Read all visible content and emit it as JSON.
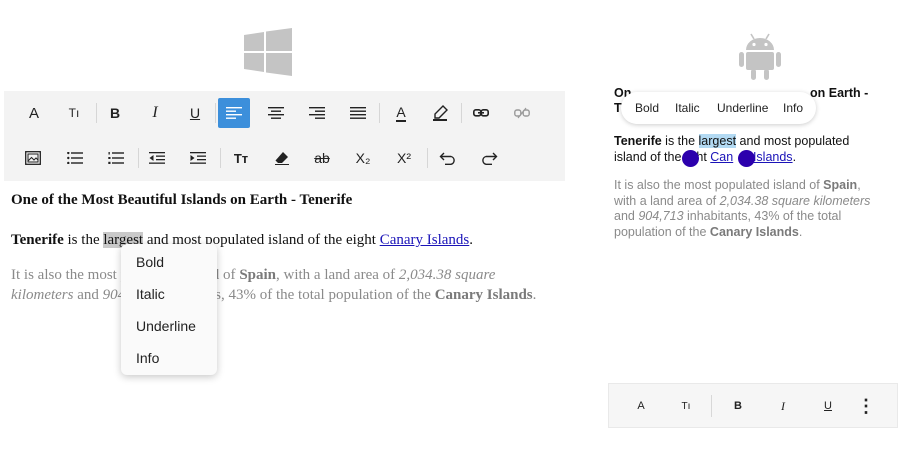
{
  "toolbar": {
    "row1": [
      {
        "name": "font-name-button",
        "icon": "font-name-icon",
        "glyph": "A"
      },
      {
        "name": "font-size-button",
        "icon": "font-size-icon",
        "glyph": "Tı"
      },
      {
        "name": "bold-button",
        "icon": "bold-icon",
        "glyph": "B"
      },
      {
        "name": "italic-button",
        "icon": "italic-icon",
        "glyph": "I"
      },
      {
        "name": "underline-button",
        "icon": "underline-icon",
        "glyph": "U"
      },
      {
        "name": "align-left-button",
        "icon": "align-left-icon",
        "active": true
      },
      {
        "name": "align-center-button",
        "icon": "align-center-icon"
      },
      {
        "name": "align-right-button",
        "icon": "align-right-icon"
      },
      {
        "name": "align-justify-button",
        "icon": "align-justify-icon"
      },
      {
        "name": "font-color-button",
        "icon": "font-color-icon",
        "glyph": "A"
      },
      {
        "name": "highlight-color-button",
        "icon": "highlighter-icon"
      },
      {
        "name": "insert-link-button",
        "icon": "link-icon"
      },
      {
        "name": "remove-link-button",
        "icon": "unlink-icon",
        "disabled": true
      }
    ],
    "row2": [
      {
        "name": "insert-image-button",
        "icon": "image-icon"
      },
      {
        "name": "bullet-list-button",
        "icon": "bullet-list-icon"
      },
      {
        "name": "numbered-list-button",
        "icon": "numbered-list-icon"
      },
      {
        "name": "decrease-indent-button",
        "icon": "outdent-icon"
      },
      {
        "name": "increase-indent-button",
        "icon": "indent-icon"
      },
      {
        "name": "text-case-button",
        "icon": "text-case-icon",
        "glyph": "Tт"
      },
      {
        "name": "clear-format-button",
        "icon": "eraser-icon"
      },
      {
        "name": "strikethrough-button",
        "icon": "strikethrough-icon",
        "glyph": "ab"
      },
      {
        "name": "subscript-button",
        "icon": "subscript-icon",
        "glyph": "X₂"
      },
      {
        "name": "superscript-button",
        "icon": "superscript-icon",
        "glyph": "X²"
      },
      {
        "name": "undo-button",
        "icon": "undo-icon"
      },
      {
        "name": "redo-button",
        "icon": "redo-icon"
      }
    ]
  },
  "document": {
    "title": "One of the Most Beautiful Islands on Earth - Tenerife",
    "p1": {
      "bold": "Tenerife",
      "t1": " is the ",
      "selected": "largest",
      "t2": " and most populated island of the eight ",
      "link": "Canary Islands",
      "t3": "."
    },
    "p2": {
      "t1": "It is also the most populated island of ",
      "bold1": "Spain",
      "t2": ", with a land area of ",
      "italic1": "2,034.38 square kilometers",
      "t3": " and ",
      "italic2": "904,713",
      "t4": " inhabitants, 43% of the total population of the ",
      "bold2": "Canary Islands",
      "t5": "."
    }
  },
  "context_menu": {
    "items": [
      "Bold",
      "Italic",
      "Underline",
      "Info"
    ]
  },
  "mobile": {
    "title_left_1": "On",
    "title_left_2": "T",
    "title_right": "on Earth -",
    "popup_items": [
      "Bold",
      "Italic",
      "Underline",
      "Info"
    ],
    "p1_line2_a": "island of the",
    "p1_line2_b": "ght ",
    "p1_link_a": "Can",
    "p1_link_b": "y Islands",
    "toolbar": [
      {
        "name": "mobile-font-name-button",
        "icon": "font-name-icon",
        "glyph": "A"
      },
      {
        "name": "mobile-font-size-button",
        "icon": "font-size-icon",
        "glyph": "Tı"
      },
      {
        "name": "mobile-bold-button",
        "icon": "bold-icon",
        "glyph": "B"
      },
      {
        "name": "mobile-italic-button",
        "icon": "italic-icon",
        "glyph": "I"
      },
      {
        "name": "mobile-underline-button",
        "icon": "underline-icon",
        "glyph": "U"
      },
      {
        "name": "mobile-more-button",
        "icon": "more-vertical-icon",
        "glyph": "⋮"
      }
    ]
  },
  "colors": {
    "accent": "#3c8fdb",
    "link": "#1a13b8",
    "selection_mobile": "#b3daf3",
    "handle": "#2c00ad",
    "muted_text": "#8a8a8a"
  }
}
